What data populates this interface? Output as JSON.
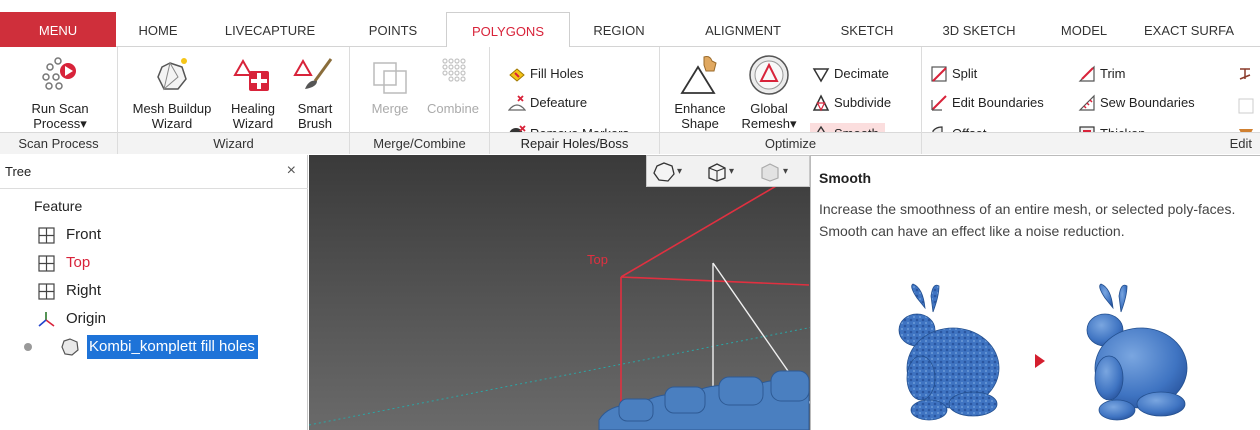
{
  "tabs": [
    {
      "label": "MENU"
    },
    {
      "label": "HOME"
    },
    {
      "label": "LIVECAPTURE"
    },
    {
      "label": "POINTS"
    },
    {
      "label": "POLYGONS"
    },
    {
      "label": "REGION"
    },
    {
      "label": "ALIGNMENT"
    },
    {
      "label": "SKETCH"
    },
    {
      "label": "3D SKETCH"
    },
    {
      "label": "MODEL"
    },
    {
      "label": "EXACT SURFA"
    }
  ],
  "active_tab": "POLYGONS",
  "ribbon": {
    "scan_process": {
      "title": "Scan Process",
      "run_scan": "Run Scan",
      "run_scan_2": "Process▾"
    },
    "wizard": {
      "title": "Wizard",
      "mesh_buildup": "Mesh Buildup",
      "mesh_buildup_2": "Wizard",
      "healing": "Healing",
      "healing_2": "Wizard",
      "smart": "Smart",
      "smart_2": "Brush"
    },
    "merge_combine": {
      "title": "Merge/Combine",
      "merge": "Merge",
      "combine": "Combine"
    },
    "repair": {
      "title": "Repair Holes/Boss",
      "fill_holes": "Fill Holes",
      "defeature": "Defeature",
      "remove_markers": "Remove Markers"
    },
    "optimize": {
      "title": "Optimize",
      "enhance": "Enhance",
      "enhance_2": "Shape",
      "global": "Global",
      "global_2": "Remesh▾",
      "decimate": "Decimate",
      "subdivide": "Subdivide",
      "smooth": "Smooth"
    },
    "edit": {
      "title": "Edit",
      "split": "Split",
      "edit_boundaries": "Edit Boundaries",
      "offset": "Offset",
      "trim": "Trim",
      "sew_boundaries": "Sew Boundaries",
      "thicken": "Thicken"
    }
  },
  "tree": {
    "title": "Tree",
    "close": "×",
    "feature": "Feature",
    "items": [
      {
        "label": "Front"
      },
      {
        "label": "Top"
      },
      {
        "label": "Right"
      },
      {
        "label": "Origin"
      },
      {
        "label": "Kombi_komplett fill holes"
      }
    ]
  },
  "viewport": {
    "plane_label": "Top"
  },
  "tooltip": {
    "title": "Smooth",
    "description": "Increase the smoothness of an entire mesh, or selected poly-faces. Smooth can have an effect like a noise reduction."
  },
  "colors": {
    "menu_red": "#cf2f3b",
    "accent_red": "#d8233a",
    "selection": "#1e73d8",
    "mesh_blue": "#4a7fc0"
  }
}
